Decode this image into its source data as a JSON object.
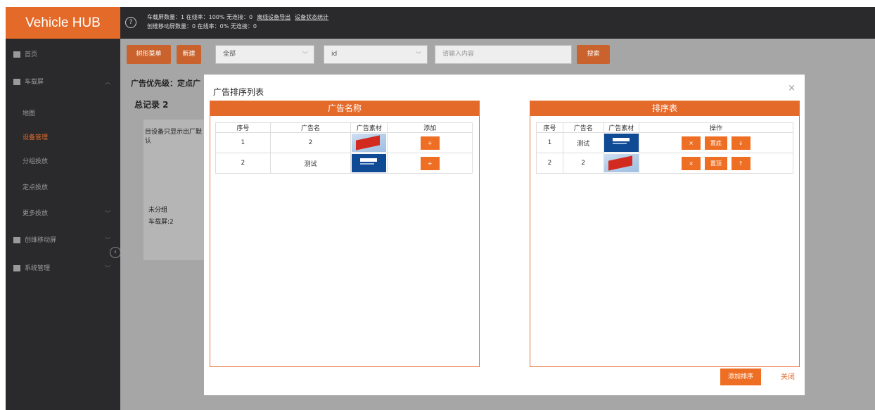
{
  "header": {
    "brand": "Vehicle HUB",
    "help_icon": "help-circle-icon",
    "stats_line1": "车载屏数量：1  在线率：100%  无连接：0",
    "stats_link1": "离线设备导出",
    "stats_link2": "设备状态统计",
    "stats_line2": "创维移动屏数量：0  在线率：0%  无连接：0"
  },
  "sidebar": {
    "items": [
      {
        "label": "首页",
        "icon": "home-icon"
      },
      {
        "label": "车载屏",
        "icon": "car-icon"
      },
      {
        "label": "地图"
      },
      {
        "label": "设备管理"
      },
      {
        "label": "分组投放"
      },
      {
        "label": "定点投放"
      },
      {
        "label": "更多投放"
      },
      {
        "label": "创维移动屏",
        "icon": "device-icon"
      },
      {
        "label": "系统管理",
        "icon": "settings-icon"
      }
    ],
    "collapse_icon": "chevron-left-icon"
  },
  "toolbar": {
    "tree_menu": "树形菜单",
    "new": "新建",
    "select1": "全部",
    "select2": "id",
    "search_placeholder": "请输入内容",
    "search": "搜索"
  },
  "main": {
    "priority_label": "广告优先级：定点广",
    "total_label": "总记录 2",
    "notice": "目设备只显示出厂默认",
    "group": "未分组",
    "screen_count": "车载屏:2"
  },
  "modal": {
    "title": "广告排序列表",
    "close_icon": "close-icon",
    "left_panel": {
      "heading": "广告名称",
      "headers": [
        "序号",
        "广告名",
        "广告素材",
        "添加"
      ],
      "rows": [
        {
          "index": "1",
          "name": "2",
          "thumb": "flag",
          "action": "+"
        },
        {
          "index": "2",
          "name": "测试",
          "thumb": "logo",
          "action": "+"
        }
      ]
    },
    "right_panel": {
      "heading": "排序表",
      "headers": [
        "序号",
        "广告名",
        "广告素材",
        "操作"
      ],
      "rows": [
        {
          "index": "1",
          "name": "测试",
          "thumb": "logo",
          "remove": "×",
          "top": "置底",
          "move": "↓"
        },
        {
          "index": "2",
          "name": "2",
          "thumb": "flag",
          "remove": "×",
          "top": "置顶",
          "move": "↑"
        }
      ]
    },
    "save_button": "添加排序",
    "close_link": "关闭"
  },
  "colors": {
    "accent": "#e46a2a",
    "dark": "#2a2a2c",
    "overlay": "#a6a6a6"
  }
}
